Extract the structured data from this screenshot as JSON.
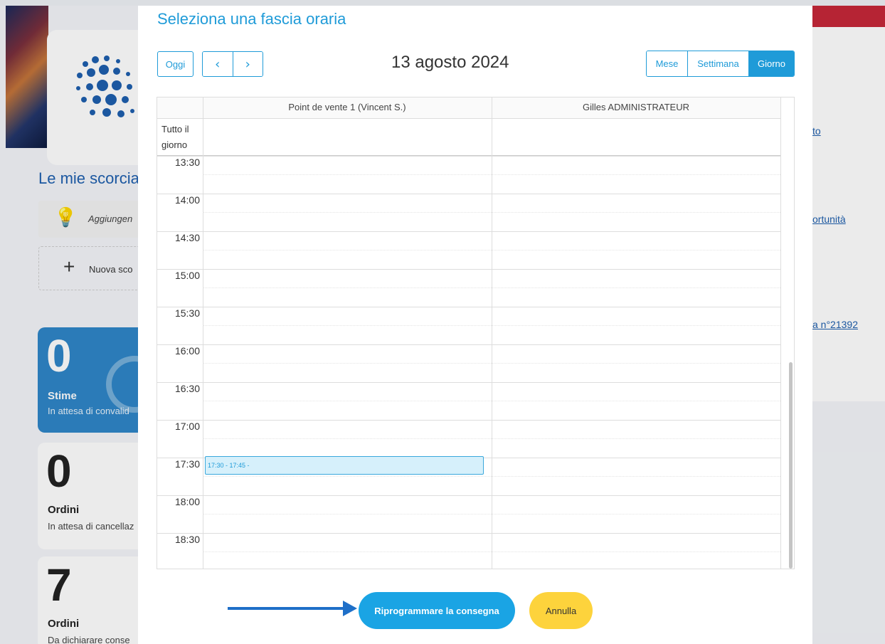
{
  "background": {
    "section_title": "Le mie scorcia",
    "tip_text": "Aggiungen",
    "add_shortcut_text": "Nuova sco",
    "links": [
      "to",
      "ortunità",
      "a n°21392"
    ],
    "stats": [
      {
        "value": "0",
        "label": "Stime",
        "sub": "In attesa di convalid"
      },
      {
        "value": "0",
        "label": "Ordini",
        "sub": "In attesa di cancellaz"
      },
      {
        "value": "7",
        "label": "Ordini",
        "sub": "Da dichiarare conse"
      }
    ],
    "brand_red": "#c62839"
  },
  "modal": {
    "title": "Seleziona una fascia oraria",
    "today_label": "Oggi",
    "prev_symbol": "‹",
    "next_symbol": "›",
    "current_date": "13 agosto 2024",
    "views": [
      "Mese",
      "Settimana",
      "Giorno"
    ],
    "active_view": "Giorno",
    "accent_color": "#1f9bd8",
    "calendar": {
      "resources": [
        "Point de vente 1 (Vincent S.)",
        "Gilles ADMINISTRATEUR"
      ],
      "all_day_label_line1": "Tutto il",
      "all_day_label_line2": "giorno",
      "time_slots": [
        "13:30",
        "14:00",
        "14:30",
        "15:00",
        "15:30",
        "16:00",
        "16:30",
        "17:00",
        "17:30",
        "18:00",
        "18:30"
      ],
      "event": {
        "label": "17:30 - 17:45 -",
        "resource": "Point de vente 1 (Vincent S.)"
      }
    },
    "reschedule_button": "Riprogrammare la consegna",
    "cancel_button": "Annulla"
  }
}
